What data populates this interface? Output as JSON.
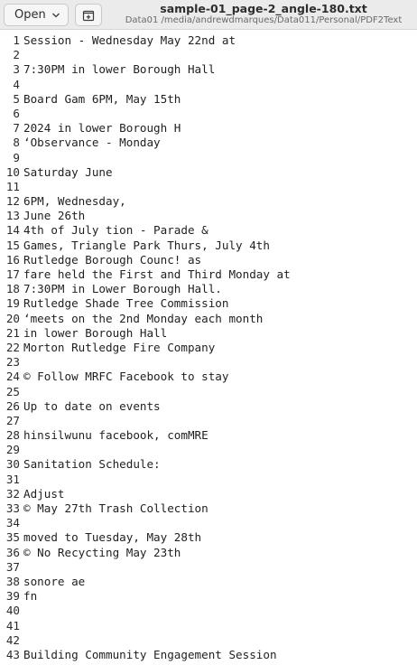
{
  "header": {
    "open_label": "Open",
    "title": "sample-01_page-2_angle-180.txt",
    "path": "Data01 /media/andrewdmarques/Data011/Personal/PDF2Text"
  },
  "editor": {
    "lines": [
      {
        "n": "1",
        "text": "Session - Wednesday May 22nd at"
      },
      {
        "n": "2",
        "text": ""
      },
      {
        "n": "3",
        "text": "7:30PM in lower Borough Hall"
      },
      {
        "n": "4",
        "text": ""
      },
      {
        "n": "5",
        "text": "Board Gam 6PM, May 15th"
      },
      {
        "n": "6",
        "text": ""
      },
      {
        "n": "7",
        "text": "2024 in lower Borough H"
      },
      {
        "n": "8",
        "text": "‘Observance - Monday"
      },
      {
        "n": "9",
        "text": ""
      },
      {
        "n": "10",
        "text": "Saturday June"
      },
      {
        "n": "11",
        "text": ""
      },
      {
        "n": "12",
        "text": "6PM, Wednesday,"
      },
      {
        "n": "13",
        "text": "June 26th"
      },
      {
        "n": "14",
        "text": "4th of July tion - Parade &"
      },
      {
        "n": "15",
        "text": "Games, Triangle Park Thurs, July 4th"
      },
      {
        "n": "16",
        "text": "Rutledge Borough Counc! as"
      },
      {
        "n": "17",
        "text": "fare held the First and Third Monday at"
      },
      {
        "n": "18",
        "text": "7:30PM in Lower Borough Hall."
      },
      {
        "n": "19",
        "text": "Rutledge Shade Tree Commission"
      },
      {
        "n": "20",
        "text": "‘meets on the 2nd Monday each month"
      },
      {
        "n": "21",
        "text": "in lower Borough Hall"
      },
      {
        "n": "22",
        "text": "Morton Rutledge Fire Company"
      },
      {
        "n": "23",
        "text": ""
      },
      {
        "n": "24",
        "text": "© Follow MRFC Facebook to stay"
      },
      {
        "n": "25",
        "text": ""
      },
      {
        "n": "26",
        "text": "Up to date on events"
      },
      {
        "n": "27",
        "text": ""
      },
      {
        "n": "28",
        "text": "hinsilwunu facebook, comMRE"
      },
      {
        "n": "29",
        "text": ""
      },
      {
        "n": "30",
        "text": "Sanitation Schedule:"
      },
      {
        "n": "31",
        "text": ""
      },
      {
        "n": "32",
        "text": "Adjust"
      },
      {
        "n": "33",
        "text": "© May 27th Trash Collection"
      },
      {
        "n": "34",
        "text": ""
      },
      {
        "n": "35",
        "text": "moved to Tuesday, May 28th"
      },
      {
        "n": "36",
        "text": "© No Recycting May 23th"
      },
      {
        "n": "37",
        "text": ""
      },
      {
        "n": "38",
        "text": "sonore ae"
      },
      {
        "n": "39",
        "text": "fn"
      },
      {
        "n": "40",
        "text": ""
      },
      {
        "n": "41",
        "text": ""
      },
      {
        "n": "42",
        "text": ""
      },
      {
        "n": "43",
        "text": "Building Community Engagement Session"
      }
    ]
  },
  "icons": {
    "open_dropdown": "chevron-down-icon",
    "new_tab": "new-tab-icon"
  }
}
